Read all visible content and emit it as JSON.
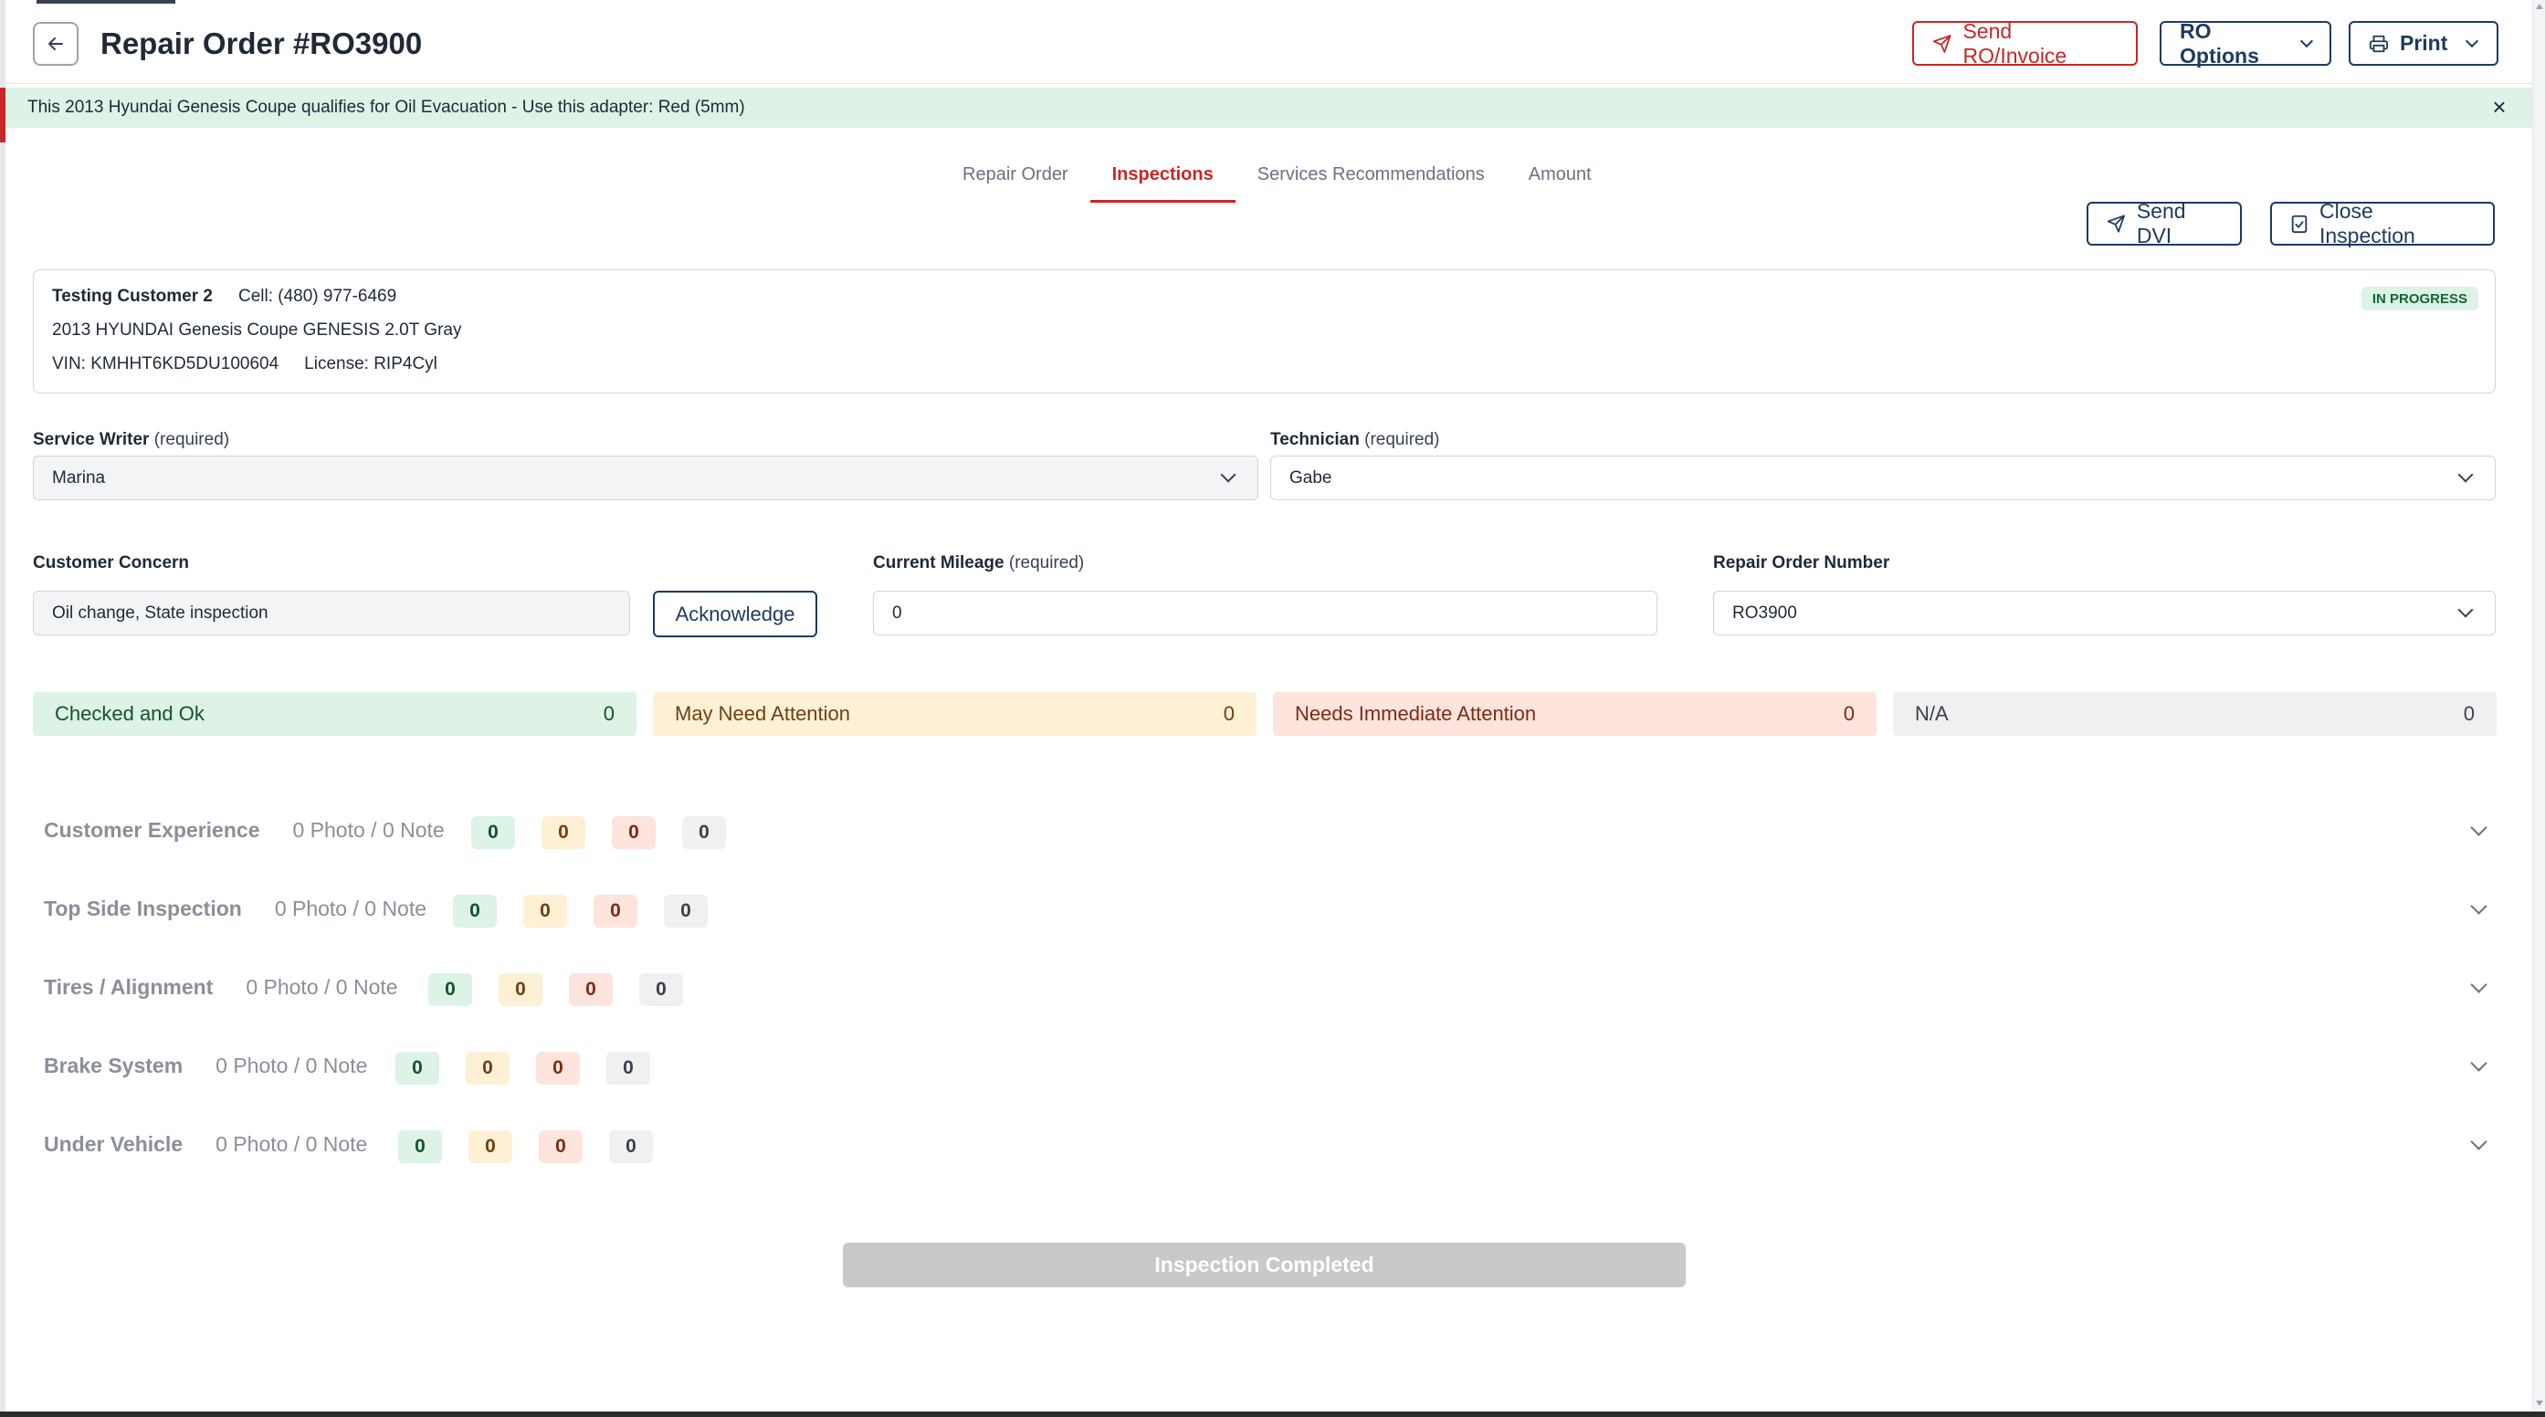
{
  "header": {
    "title": "Repair Order #RO3900",
    "send_label": "Send RO/Invoice",
    "options_label": "RO Options",
    "print_label": "Print"
  },
  "alert": {
    "text": "This 2013 Hyundai Genesis Coupe qualifies for Oil Evacuation - Use this adapter: Red (5mm)",
    "close": "×"
  },
  "tabs": [
    {
      "label": "Repair Order"
    },
    {
      "label": "Inspections"
    },
    {
      "label": "Services Recommendations"
    },
    {
      "label": "Amount"
    }
  ],
  "actions": {
    "send_dvi": "Send DVI",
    "close_inspection": "Close Inspection"
  },
  "customer": {
    "name": "Testing Customer 2",
    "cell": "Cell: (480) 977-6469",
    "vehicle": "2013 HYUNDAI Genesis Coupe GENESIS 2.0T Gray",
    "vin": "VIN: KMHHT6KD5DU100604",
    "license": "License: RIP4Cyl",
    "status": "IN PROGRESS"
  },
  "form": {
    "service_writer_label": "Service Writer",
    "service_writer_req": "(required)",
    "service_writer_value": "Marina",
    "technician_label": "Technician",
    "technician_req": "(required)",
    "technician_value": "Gabe",
    "concern_label": "Customer Concern",
    "concern_value": "Oil change,  State inspection",
    "acknowledge_label": "Acknowledge",
    "mileage_label": "Current Mileage",
    "mileage_req": "(required)",
    "mileage_value": "0",
    "ro_number_label": "Repair Order Number",
    "ro_number_value": "RO3900"
  },
  "summary": [
    {
      "label": "Checked and Ok",
      "count": "0"
    },
    {
      "label": "May Need Attention",
      "count": "0"
    },
    {
      "label": "Needs Immediate Attention",
      "count": "0"
    },
    {
      "label": "N/A",
      "count": "0"
    }
  ],
  "sections": [
    {
      "name": "Customer Experience",
      "counts": "0 Photo / 0 Note",
      "ok": "0",
      "may": "0",
      "need": "0",
      "na": "0"
    },
    {
      "name": "Top Side Inspection",
      "counts": "0 Photo / 0 Note",
      "ok": "0",
      "may": "0",
      "need": "0",
      "na": "0"
    },
    {
      "name": "Tires / Alignment",
      "counts": "0 Photo / 0 Note",
      "ok": "0",
      "may": "0",
      "need": "0",
      "na": "0"
    },
    {
      "name": "Brake System",
      "counts": "0 Photo / 0 Note",
      "ok": "0",
      "may": "0",
      "need": "0",
      "na": "0"
    },
    {
      "name": "Under Vehicle",
      "counts": "0 Photo / 0 Note",
      "ok": "0",
      "may": "0",
      "need": "0",
      "na": "0"
    }
  ],
  "footer": {
    "complete_label": "Inspection Completed"
  },
  "colors": {
    "accent_red": "#c62828",
    "navy": "#1e3a5f",
    "ok_bg": "#dcf3e6",
    "may_bg": "#fdf0d5",
    "need_bg": "#fde4dc",
    "na_bg": "#f0f0f0"
  }
}
